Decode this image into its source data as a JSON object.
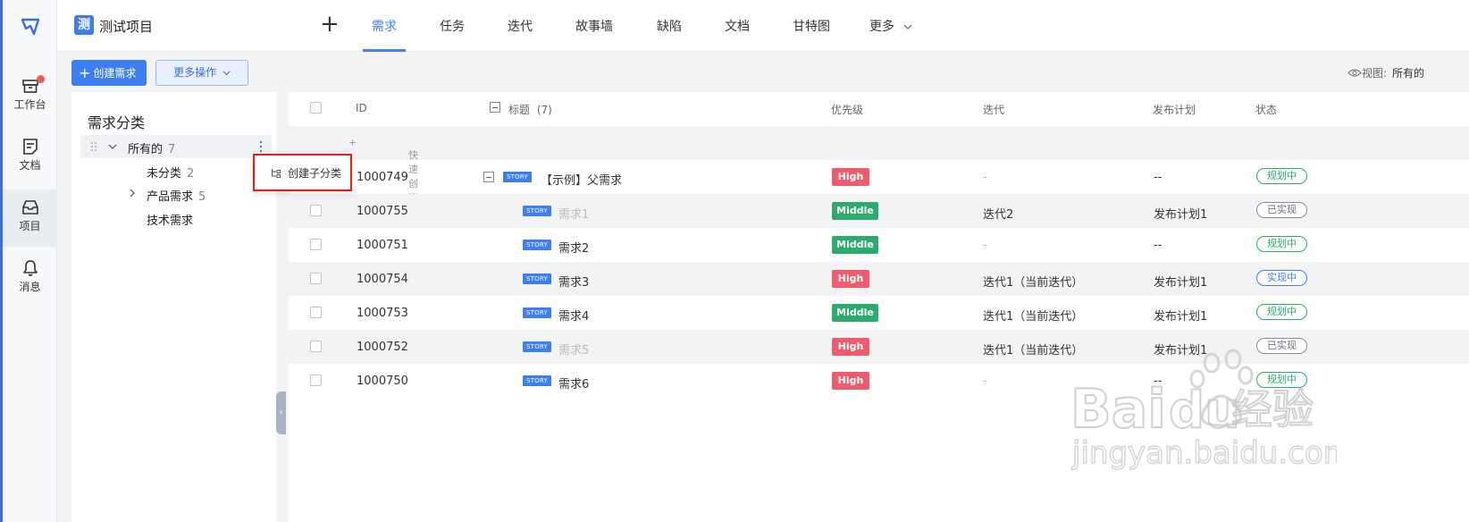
{
  "rail": {
    "items": [
      {
        "label": "工作台",
        "icon": "workbench-icon",
        "badge": true
      },
      {
        "label": "文档",
        "icon": "document-icon"
      },
      {
        "label": "项目",
        "icon": "project-icon",
        "active": true
      },
      {
        "label": "消息",
        "icon": "bell-icon"
      }
    ]
  },
  "header": {
    "project_icon_char": "测",
    "project_name": "测试项目",
    "add": "+",
    "tabs": [
      {
        "label": "需求",
        "active": true
      },
      {
        "label": "任务"
      },
      {
        "label": "迭代"
      },
      {
        "label": "故事墙"
      },
      {
        "label": "缺陷"
      },
      {
        "label": "文档"
      },
      {
        "label": "甘特图"
      },
      {
        "label": "更多"
      }
    ]
  },
  "toolbar": {
    "create_label": "创建需求",
    "more_label": "更多操作",
    "view_label": "视图:",
    "view_value": "所有的"
  },
  "categories": {
    "title": "需求分类",
    "all": {
      "label": "所有的",
      "count": "7"
    },
    "items": [
      {
        "label": "未分类",
        "count": "2"
      },
      {
        "label": "产品需求",
        "count": "5"
      },
      {
        "label": "技术需求",
        "count": ""
      }
    ]
  },
  "context_menu": {
    "item": "创建子分类"
  },
  "table": {
    "columns": {
      "id": "ID",
      "title": "标题",
      "title_count": "(7)",
      "priority": "优先级",
      "iteration": "迭代",
      "release": "发布计划",
      "status": "状态"
    },
    "quick_create": "快速创建",
    "story_tag": "STORY",
    "rows": [
      {
        "id": "1000749",
        "title": "【示例】父需求",
        "priority": "High",
        "iteration": "-",
        "release": "--",
        "status": "规划中",
        "status_kind": "plan",
        "parent": true,
        "muted": false
      },
      {
        "id": "1000755",
        "title": "需求1",
        "priority": "Middle",
        "iteration": "迭代2",
        "release": "发布计划1",
        "status": "已实现",
        "status_kind": "done",
        "muted": true
      },
      {
        "id": "1000751",
        "title": "需求2",
        "priority": "Middle",
        "iteration": "-",
        "release": "--",
        "status": "规划中",
        "status_kind": "plan",
        "muted": false
      },
      {
        "id": "1000754",
        "title": "需求3",
        "priority": "High",
        "iteration": "迭代1（当前迭代）",
        "release": "发布计划1",
        "status": "实现中",
        "status_kind": "doing",
        "muted": false
      },
      {
        "id": "1000753",
        "title": "需求4",
        "priority": "Middle",
        "iteration": "迭代1（当前迭代）",
        "release": "发布计划1",
        "status": "规划中",
        "status_kind": "plan",
        "muted": false
      },
      {
        "id": "1000752",
        "title": "需求5",
        "priority": "High",
        "iteration": "迭代1（当前迭代）",
        "release": "发布计划1",
        "status": "已实现",
        "status_kind": "done",
        "muted": true
      },
      {
        "id": "1000750",
        "title": "需求6",
        "priority": "High",
        "iteration": "-",
        "release": "--",
        "status": "规划中",
        "status_kind": "plan",
        "muted": false
      }
    ]
  },
  "watermark": {
    "brand": "Baidu",
    "cn": "经验",
    "url": "jingyan.baidu.com"
  },
  "colors": {
    "accent": "#3d7ff0",
    "high": "#f15b6c",
    "middle": "#2bab6c",
    "highlight": "#e02020"
  }
}
